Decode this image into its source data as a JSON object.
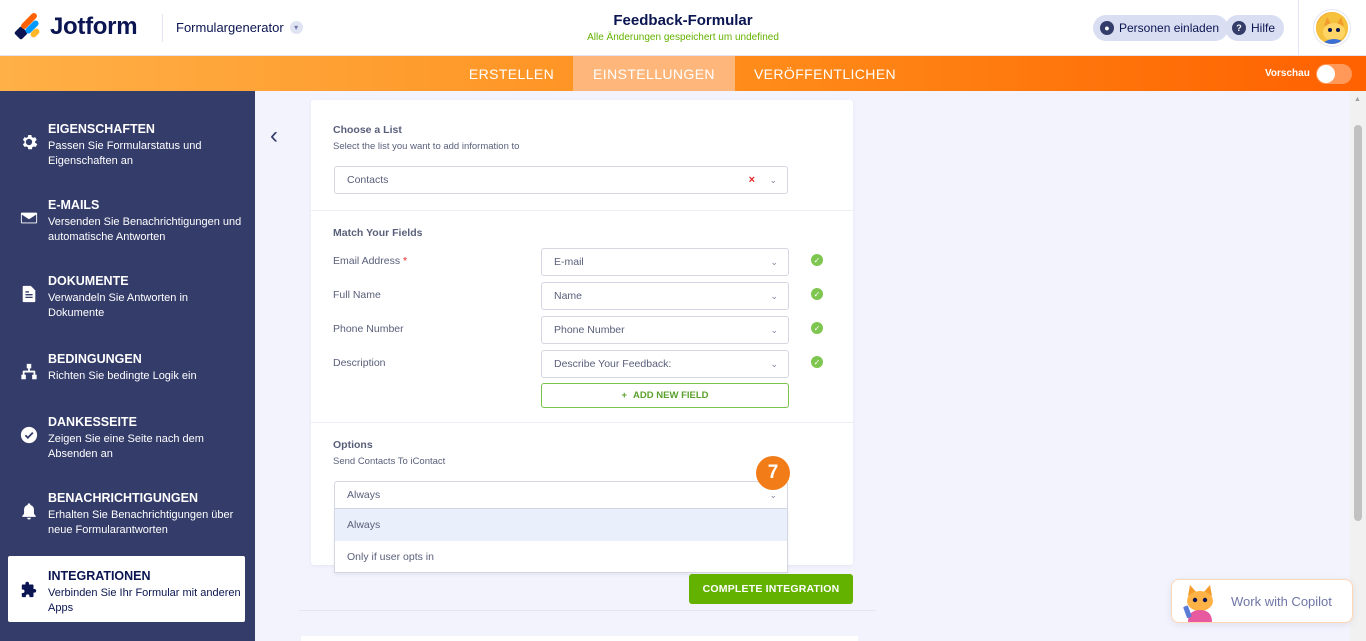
{
  "header": {
    "logo_text": "Jotform",
    "form_generator": "Formulargenerator",
    "form_title": "Feedback-Formular",
    "save_status": "Alle Änderungen gespeichert um undefined",
    "invite_label": "Personen einladen",
    "help_label": "Hilfe"
  },
  "nav": {
    "tabs": [
      {
        "label": "ERSTELLEN",
        "active": false
      },
      {
        "label": "EINSTELLUNGEN",
        "active": true
      },
      {
        "label": "VERÖFFENTLICHEN",
        "active": false
      }
    ],
    "preview_label": "Vorschau",
    "preview_on": false
  },
  "sidebar": {
    "items": [
      {
        "icon": "gear-icon",
        "title": "EIGENSCHAFTEN",
        "desc": "Passen Sie Formularstatus und Eigenschaften an",
        "active": false
      },
      {
        "icon": "envelope-icon",
        "title": "E-MAILS",
        "desc": "Versenden Sie Benachrichtigungen und automatische Antworten",
        "active": false
      },
      {
        "icon": "document-icon",
        "title": "DOKUMENTE",
        "desc": "Verwandeln Sie Antworten in Dokumente",
        "active": false
      },
      {
        "icon": "sitemap-icon",
        "title": "BEDINGUNGEN",
        "desc": "Richten Sie bedingte Logik ein",
        "active": false
      },
      {
        "icon": "check-circle-icon",
        "title": "DANKESSEITE",
        "desc": "Zeigen Sie eine Seite nach dem Absenden an",
        "active": false
      },
      {
        "icon": "bell-icon",
        "title": "BENACHRICHTIGUNGEN",
        "desc": "Erhalten Sie Benachrichtigungen über neue Formularantworten",
        "active": false
      },
      {
        "icon": "puzzle-icon",
        "title": "INTEGRATIONEN",
        "desc": "Verbinden Sie Ihr Formular mit anderen Apps",
        "active": true
      }
    ]
  },
  "integration": {
    "choose_list_title": "Choose a List",
    "choose_list_sub": "Select the list you want to add information to",
    "list_value": "Contacts",
    "match_title": "Match Your Fields",
    "fields": [
      {
        "label": "Email Address",
        "required": true,
        "value": "E-mail"
      },
      {
        "label": "Full Name",
        "required": false,
        "value": "Name"
      },
      {
        "label": "Phone Number",
        "required": false,
        "value": "Phone Number"
      },
      {
        "label": "Description",
        "required": false,
        "value": "Describe Your Feedback:"
      }
    ],
    "required_mark": "*",
    "add_field_label": "ADD NEW FIELD",
    "options_title": "Options",
    "options_sub": "Send Contacts To iContact",
    "options_value": "Always",
    "options_list": [
      "Always",
      "Only if user opts in"
    ],
    "complete_label": "COMPLETE INTEGRATION"
  },
  "step_badge": "7",
  "copilot_label": "Work with Copilot",
  "colors": {
    "sidebar_bg": "#343c6a",
    "accent_orange": "#ff6100",
    "success_green": "#64b200"
  }
}
